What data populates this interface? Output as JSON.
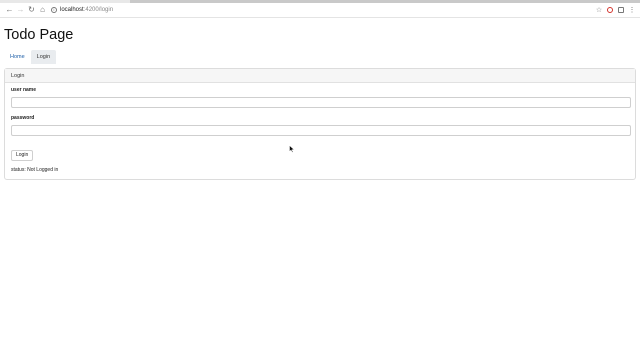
{
  "browser": {
    "url_host": "localhost",
    "url_rest": ":4200/login"
  },
  "page": {
    "title": "Todo Page"
  },
  "tabs": [
    {
      "label": "Home",
      "active": false
    },
    {
      "label": "Login",
      "active": true
    }
  ],
  "card": {
    "header": "Login",
    "username_label": "user name",
    "username_value": "",
    "password_label": "password",
    "password_value": "",
    "login_button": "Login",
    "status_prefix": "status:",
    "status_value": "Not Logged in"
  },
  "colors": {
    "link": "#1e5fa8",
    "active_tab_bg": "#e9ecef",
    "card_header_bg": "#f6f6f6"
  }
}
